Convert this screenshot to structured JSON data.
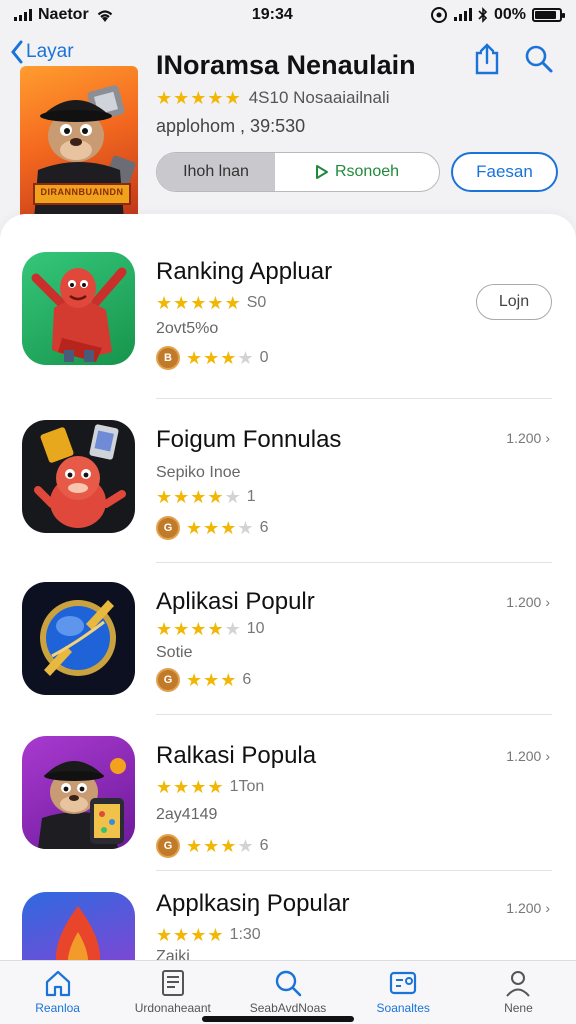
{
  "status_bar": {
    "carrier": "Naetor",
    "time": "19:34",
    "battery": "00%"
  },
  "header": {
    "back_label": "Layar",
    "title": "INoramsa Nenaulain",
    "rating_count": "4S10 Nosaaiailnali",
    "subtitle": "applohom , 39:530",
    "seg_a_label": "Ihoh lnan",
    "seg_b_label": "Rsonoeh",
    "follow_label": "Faesan",
    "thumb_banner": "DIRANNBUAINDN"
  },
  "apps": [
    {
      "name": "Ranking Appluar",
      "stars": 5,
      "rating_text": "S0",
      "meta": "2ovt5%o",
      "badge_icon": "B",
      "badge_stars": 3,
      "badge_text": "0",
      "action": "Lojn"
    },
    {
      "name": "Foigum Fonnulas",
      "stars": 4,
      "rating_text": "1",
      "meta": "Sepiko Inoe",
      "badge_icon": "G",
      "badge_stars": 3,
      "badge_text": "6",
      "price": "1.200"
    },
    {
      "name": "Aplikasi Populr",
      "stars": 4,
      "rating_text": "10",
      "meta": "Sotie",
      "badge_icon": "G",
      "badge_stars": 3,
      "badge_text": "6",
      "price": "1.200"
    },
    {
      "name": "Ralkasi Popula",
      "stars": 4,
      "rating_text": "1Ton",
      "meta": "2ay4149",
      "badge_icon": "G",
      "badge_stars": 3,
      "badge_text": "6",
      "price": "1.200"
    },
    {
      "name": "Applkasiŋ Popular",
      "stars": 4,
      "rating_text": "1:30",
      "meta": "Zaiki",
      "price": "1.200"
    }
  ],
  "tabs": [
    {
      "label": "Reanloa",
      "icon": "home-icon",
      "active": true
    },
    {
      "label": "Urdonaheaant",
      "icon": "book-icon",
      "active": false
    },
    {
      "label": "SeabAvdNoas",
      "icon": "search-icon",
      "active": false
    },
    {
      "label": "Soanaltes",
      "icon": "apps-icon",
      "active": false
    },
    {
      "label": "Nene",
      "icon": "profile-icon",
      "active": false
    }
  ],
  "colors": {
    "accent": "#1a73d9",
    "star": "#f2b705",
    "green": "#1f8a3a"
  }
}
